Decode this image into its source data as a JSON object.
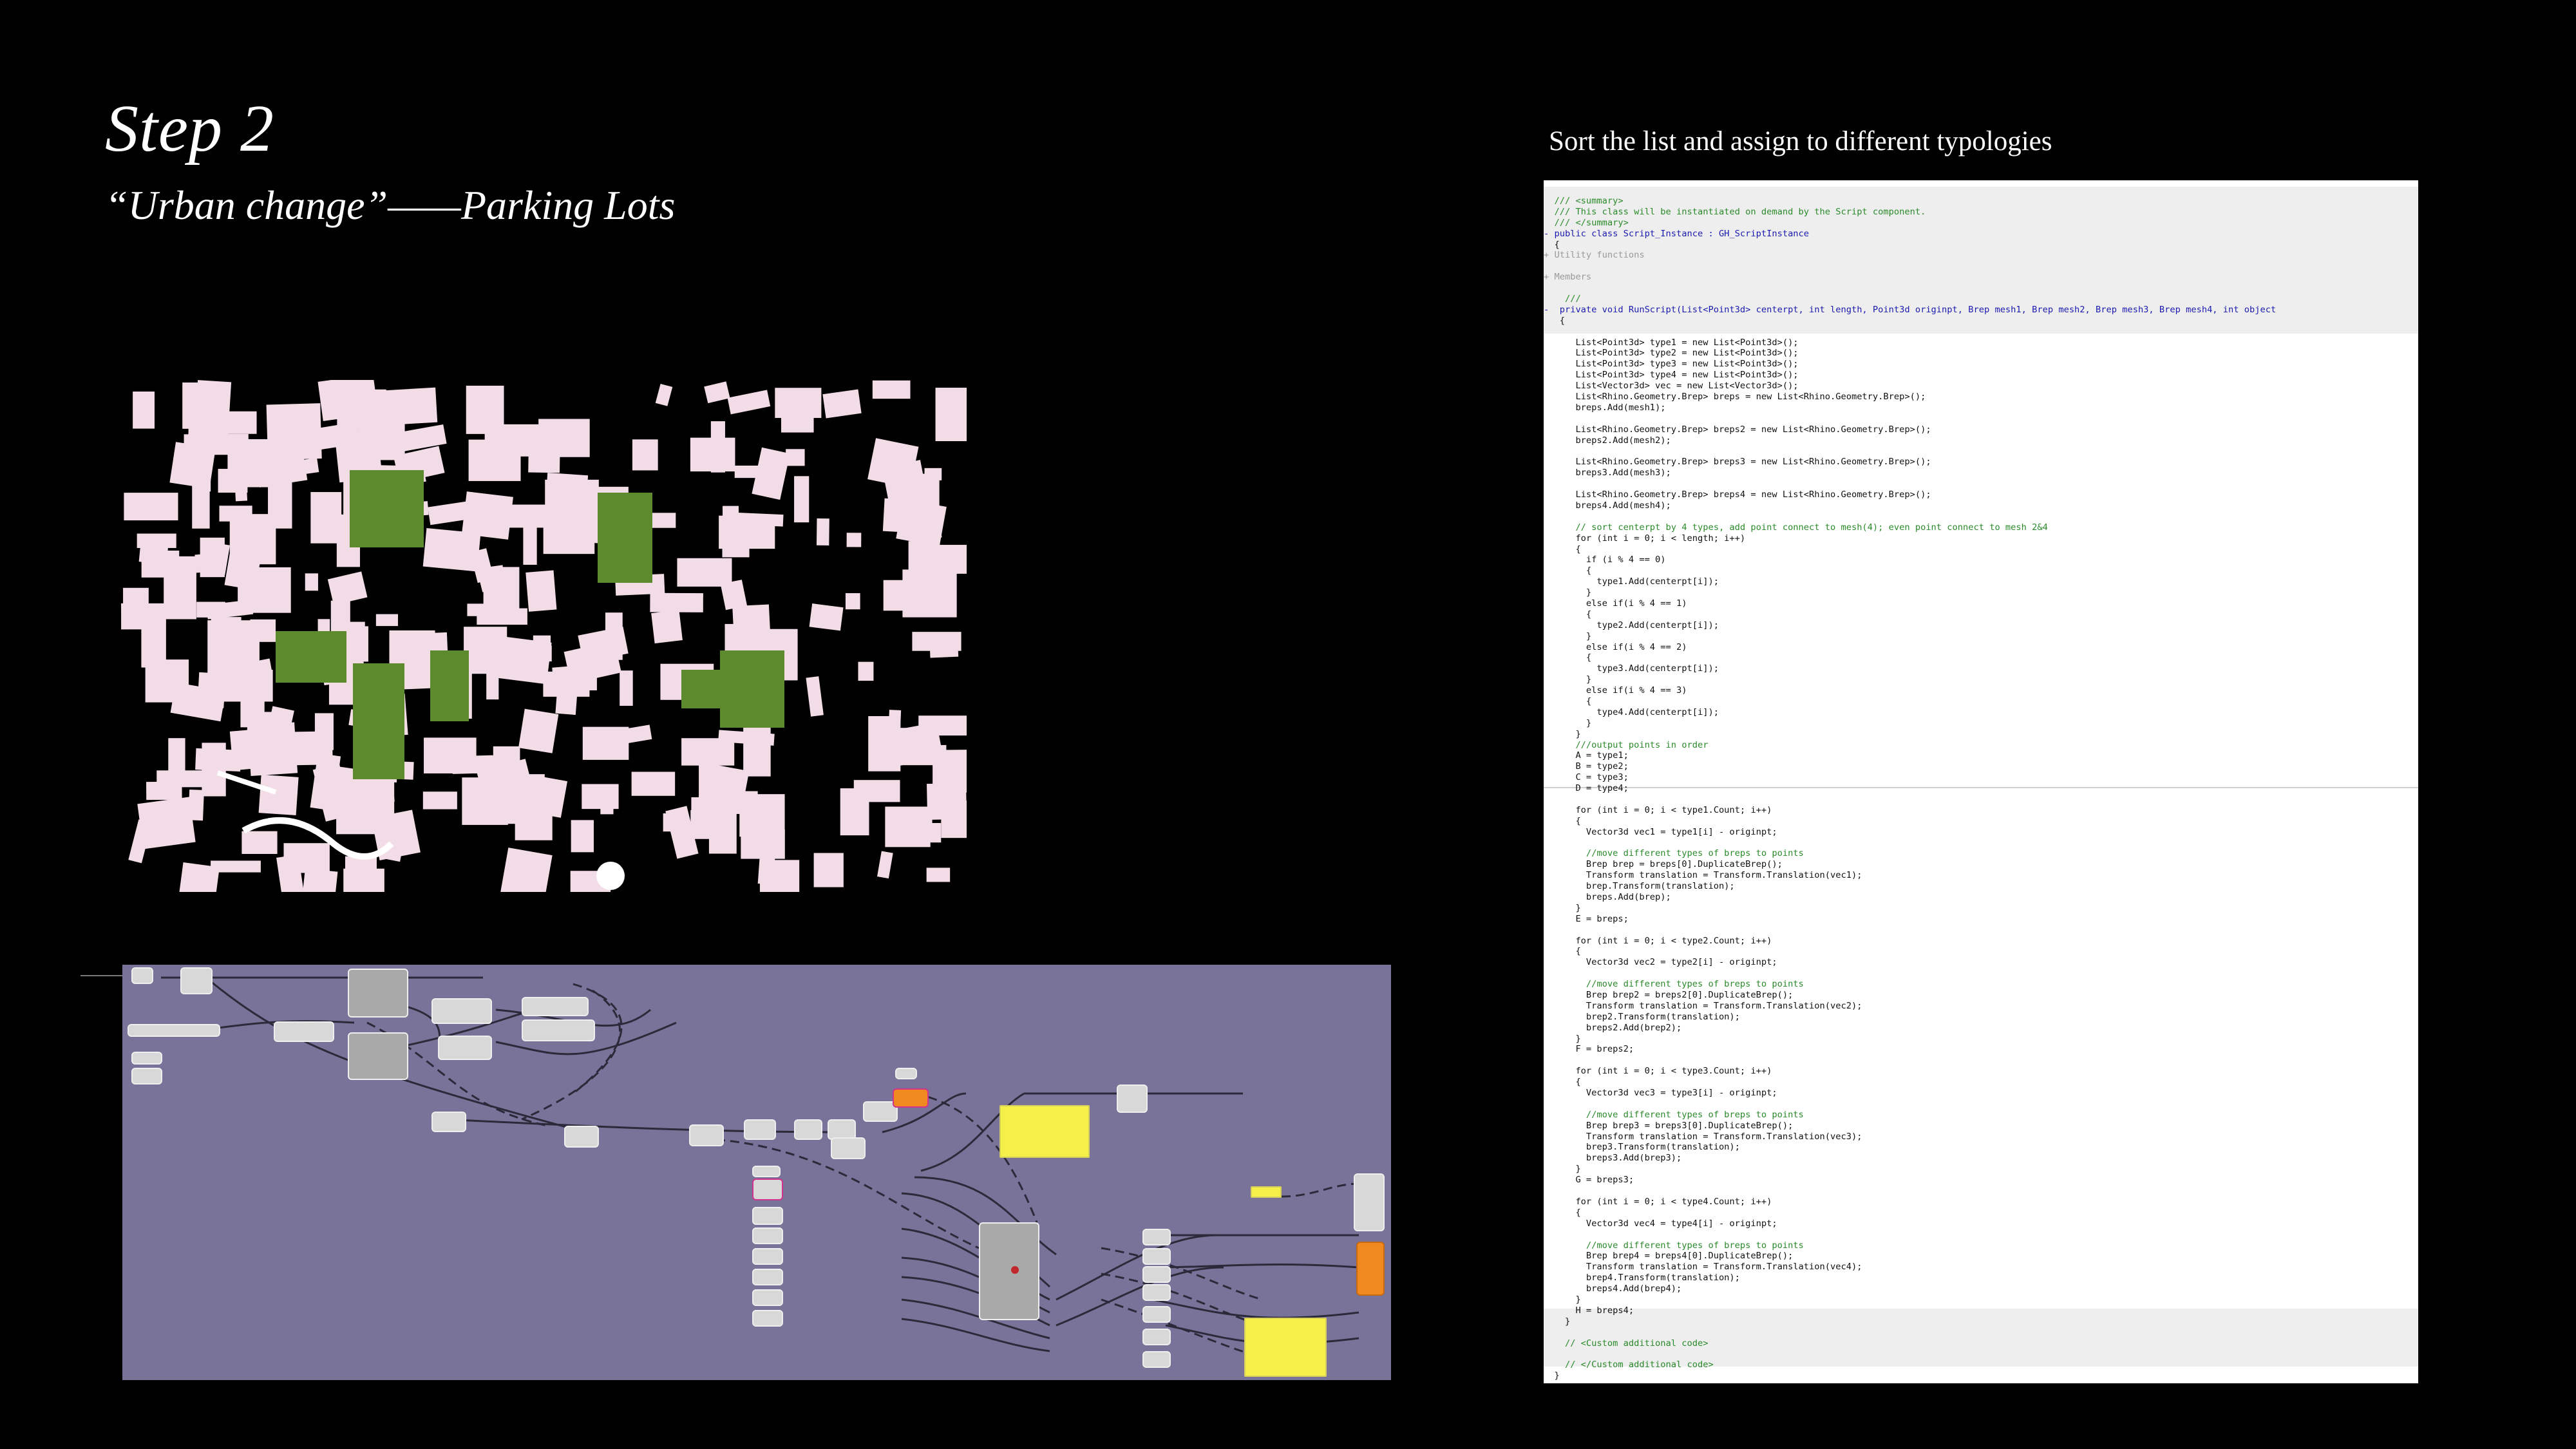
{
  "slide": {
    "title": "Step 2",
    "subtitle": "“Urban change”——Parking Lots",
    "caption": "Sort the list and assign to different typologies"
  },
  "colors": {
    "background": "#000000",
    "building_pink": "#f2dce6",
    "parking_green": "#5c8a2c",
    "gh_canvas": "#7a7399",
    "yellow_panel": "#f5ef4a",
    "orange_node": "#f08a1e",
    "code_comment": "#2a8a2a",
    "code_keyword": "#1a1ab0"
  },
  "code_lines": [
    "  /// <summary>",
    "  /// This class will be instantiated on demand by the Script component.",
    "  /// </summary>",
    "- public class Script_Instance : GH_ScriptInstance",
    "  {",
    "+ Utility functions",
    "",
    "+ Members",
    "",
    "    ///",
    "-  private void RunScript(List<Point3d> centerpt, int length, Point3d originpt, Brep mesh1, Brep mesh2, Brep mesh3, Brep mesh4, int object",
    "   {",
    "",
    "      List<Point3d> type1 = new List<Point3d>();",
    "      List<Point3d> type2 = new List<Point3d>();",
    "      List<Point3d> type3 = new List<Point3d>();",
    "      List<Point3d> type4 = new List<Point3d>();",
    "      List<Vector3d> vec = new List<Vector3d>();",
    "      List<Rhino.Geometry.Brep> breps = new List<Rhino.Geometry.Brep>();",
    "      breps.Add(mesh1);",
    "",
    "      List<Rhino.Geometry.Brep> breps2 = new List<Rhino.Geometry.Brep>();",
    "      breps2.Add(mesh2);",
    "",
    "      List<Rhino.Geometry.Brep> breps3 = new List<Rhino.Geometry.Brep>();",
    "      breps3.Add(mesh3);",
    "",
    "      List<Rhino.Geometry.Brep> breps4 = new List<Rhino.Geometry.Brep>();",
    "      breps4.Add(mesh4);",
    "",
    "      // sort centerpt by 4 types, add point connect to mesh(4); even point connect to mesh 2&4",
    "      for (int i = 0; i < length; i++)",
    "      {",
    "        if (i % 4 == 0)",
    "        {",
    "          type1.Add(centerpt[i]);",
    "        }",
    "        else if(i % 4 == 1)",
    "        {",
    "          type2.Add(centerpt[i]);",
    "        }",
    "        else if(i % 4 == 2)",
    "        {",
    "          type3.Add(centerpt[i]);",
    "        }",
    "        else if(i % 4 == 3)",
    "        {",
    "          type4.Add(centerpt[i]);",
    "        }",
    "      }",
    "      ///output points in order",
    "      A = type1;",
    "      B = type2;",
    "      C = type3;",
    "      D = type4;",
    "",
    "      for (int i = 0; i < type1.Count; i++)",
    "      {",
    "        Vector3d vec1 = type1[i] - originpt;",
    "",
    "        //move different types of breps to points",
    "        Brep brep = breps[0].DuplicateBrep();",
    "        Transform translation = Transform.Translation(vec1);",
    "        brep.Transform(translation);",
    "        breps.Add(brep);",
    "      }",
    "      E = breps;",
    "",
    "      for (int i = 0; i < type2.Count; i++)",
    "      {",
    "        Vector3d vec2 = type2[i] - originpt;",
    "",
    "        //move different types of breps to points",
    "        Brep brep2 = breps2[0].DuplicateBrep();",
    "        Transform translation = Transform.Translation(vec2);",
    "        brep2.Transform(translation);",
    "        breps2.Add(brep2);",
    "      }",
    "      F = breps2;",
    "",
    "      for (int i = 0; i < type3.Count; i++)",
    "      {",
    "        Vector3d vec3 = type3[i] - originpt;",
    "",
    "        //move different types of breps to points",
    "        Brep brep3 = breps3[0].DuplicateBrep();",
    "        Transform translation = Transform.Translation(vec3);",
    "        brep3.Transform(translation);",
    "        breps3.Add(brep3);",
    "      }",
    "      G = breps3;",
    "",
    "      for (int i = 0; i < type4.Count; i++)",
    "      {",
    "        Vector3d vec4 = type4[i] - originpt;",
    "",
    "        //move different types of breps to points",
    "        Brep brep4 = breps4[0].DuplicateBrep();",
    "        Transform translation = Transform.Translation(vec4);",
    "        brep4.Transform(translation);",
    "        breps4.Add(brep4);",
    "      }",
    "      H = breps4;",
    "    }",
    "",
    "    // <Custom additional code>",
    "",
    "    // </Custom additional code>",
    "  }"
  ]
}
